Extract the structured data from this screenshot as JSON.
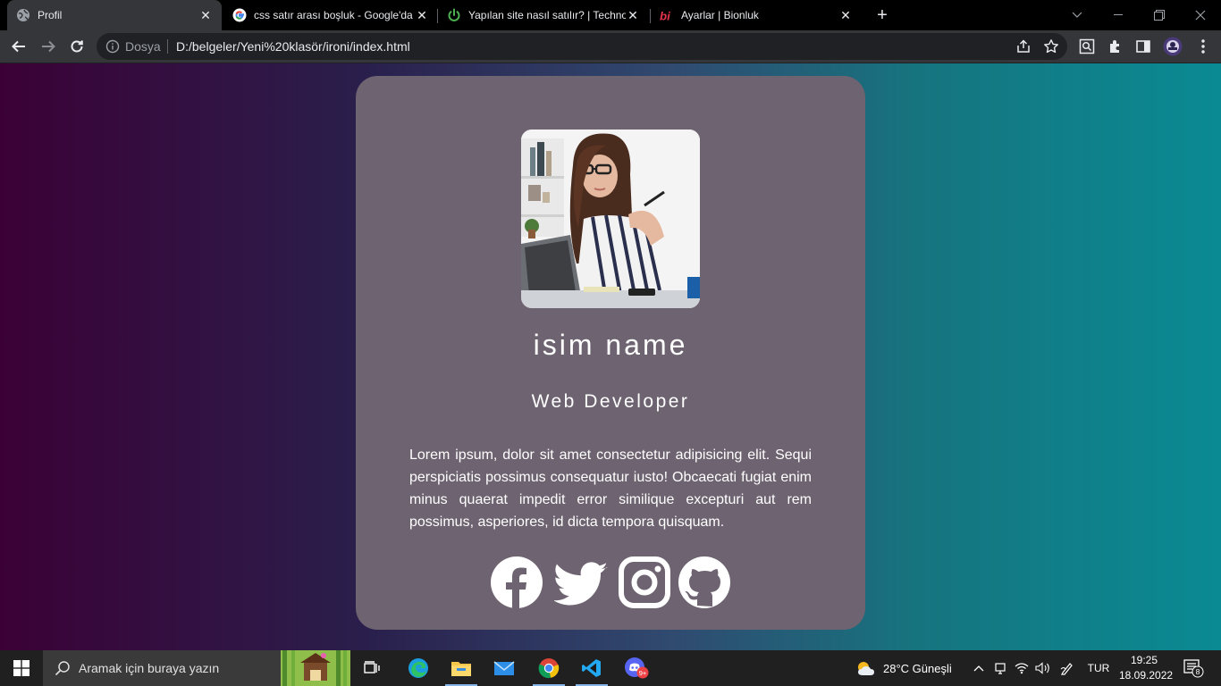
{
  "tabs": [
    {
      "title": "Profil",
      "active": true
    },
    {
      "title": "css satır arası boşluk - Google'da Ara"
    },
    {
      "title": "Yapılan site nasıl satılır? | Technopat"
    },
    {
      "title": "Ayarlar | Bionluk"
    }
  ],
  "toolbar": {
    "dosya_label": "Dosya",
    "url": "D:/belgeler/Yeni%20klasör/ironi/index.html"
  },
  "profile": {
    "name": "isim name",
    "role": "Web Developer",
    "bio": "Lorem ipsum, dolor sit amet consectetur adipisicing elit. Sequi perspiciatis possimus consequatur iusto! Obcaecati fugiat enim minus quaerat impedit error similique excepturi aut rem possimus, asperiores, id dicta tempora quisquam.",
    "socials": [
      "facebook",
      "twitter",
      "instagram",
      "github"
    ]
  },
  "taskbar": {
    "search_placeholder": "Aramak için buraya yazın",
    "weather": "28°C  Güneşli",
    "language": "TUR",
    "time": "19:25",
    "date": "18.09.2022",
    "notification_count": "8",
    "discord_badge": "9+"
  },
  "colors": {
    "card": "#6e6370",
    "gradient_left": "#3b0136",
    "gradient_right": "#0a8a93"
  }
}
